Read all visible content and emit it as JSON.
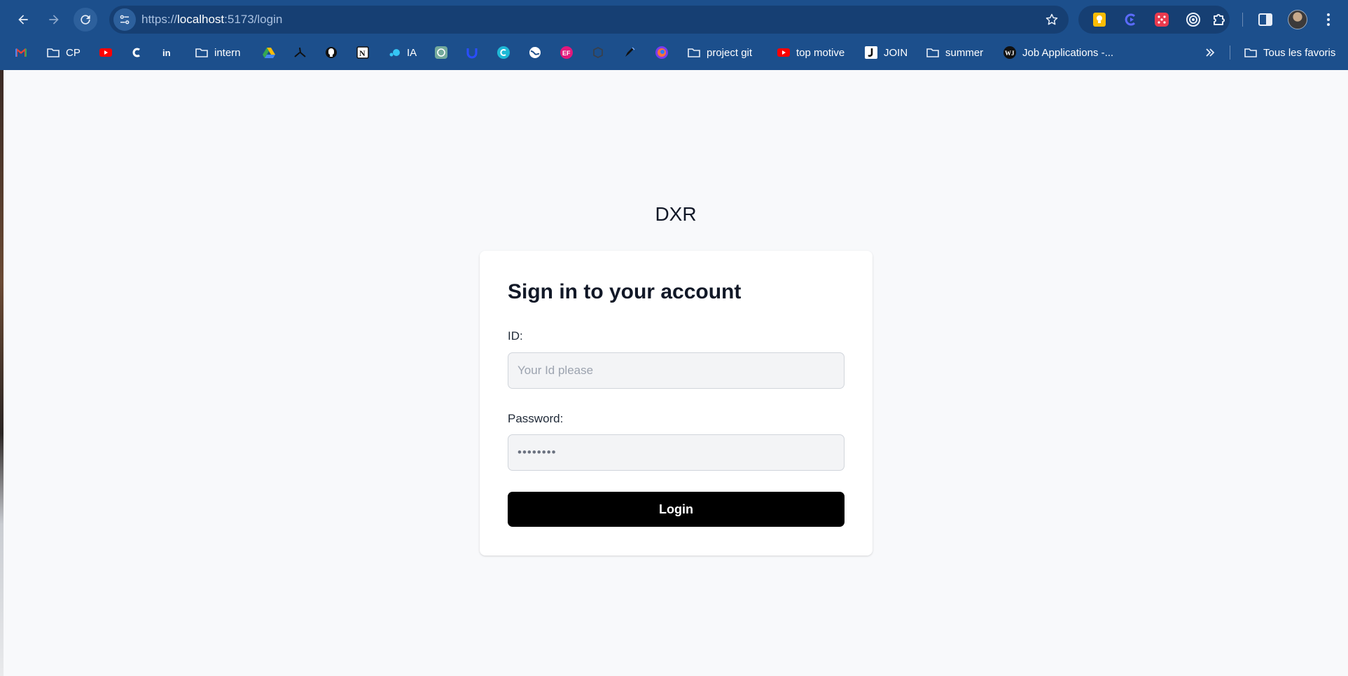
{
  "browser": {
    "url_scheme": "https://",
    "url_host": "localhost",
    "url_rest": ":5173/login",
    "bookmarks": [
      {
        "label": "",
        "icon": "gmail-icon"
      },
      {
        "label": "CP",
        "icon": "folder-icon"
      },
      {
        "label": "",
        "icon": "youtube-icon"
      },
      {
        "label": "",
        "icon": "c-logo-icon"
      },
      {
        "label": "",
        "icon": "linkedin-icon"
      },
      {
        "label": "intern",
        "icon": "folder-icon"
      },
      {
        "label": "",
        "icon": "google-drive-icon"
      },
      {
        "label": "",
        "icon": "adobe-acrobat-icon"
      },
      {
        "label": "",
        "icon": "github-icon"
      },
      {
        "label": "",
        "icon": "notion-icon"
      },
      {
        "label": "IA",
        "icon": "ia-dots-icon"
      },
      {
        "label": "",
        "icon": "chatgpt-icon"
      },
      {
        "label": "",
        "icon": "udemy-icon"
      },
      {
        "label": "",
        "icon": "canva-icon"
      },
      {
        "label": "",
        "icon": "globe-icon"
      },
      {
        "label": "",
        "icon": "ef-icon"
      },
      {
        "label": "",
        "icon": "box-icon"
      },
      {
        "label": "",
        "icon": "rocket-icon"
      },
      {
        "label": "",
        "icon": "firefox-icon"
      },
      {
        "label": "project git",
        "icon": "folder-icon"
      },
      {
        "label": "top motive",
        "icon": "youtube-icon"
      },
      {
        "label": "JOIN",
        "icon": "join-icon"
      },
      {
        "label": "summer",
        "icon": "folder-icon"
      },
      {
        "label": "Job Applications -...",
        "icon": "notion-wj-icon"
      }
    ],
    "other_bookmarks": "Tous les favoris"
  },
  "page": {
    "brand": "DXR",
    "title": "Sign in to your account",
    "id_label": "ID:",
    "id_placeholder": "Your Id please",
    "password_label": "Password:",
    "password_value": "••••••••",
    "login_label": "Login"
  },
  "colors": {
    "chrome": "#1c4f8c",
    "page_bg": "#f8f9fb",
    "button": "#000000"
  }
}
